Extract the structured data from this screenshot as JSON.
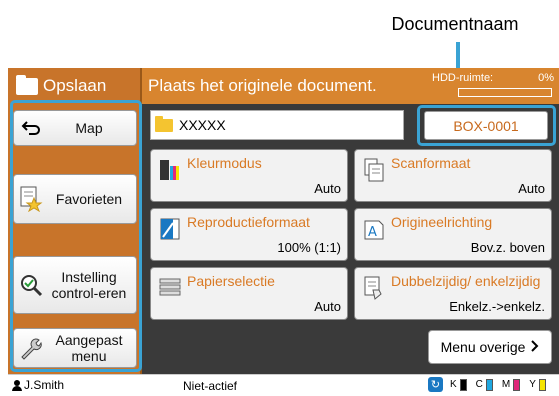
{
  "callout": {
    "label": "Documentnaam"
  },
  "header": {
    "title": "Opslaan",
    "message": "Plaats het originele document.",
    "hdd_label": "HDD-ruimte:",
    "hdd_percent": "0%",
    "hdd_fill": 0
  },
  "sidebar": {
    "items": [
      {
        "label": "Map",
        "icon": "back-arrow-icon"
      },
      {
        "label": "Favorieten",
        "icon": "favorites-star-icon"
      },
      {
        "label": "Instelling control-eren",
        "icon": "magnifier-check-icon"
      },
      {
        "label": "Aangepast menu",
        "icon": "wrench-icon"
      }
    ]
  },
  "main": {
    "document_name": "XXXXX",
    "box_button": "BOX-0001",
    "tiles": [
      {
        "title": "Kleurmodus",
        "value": "Auto"
      },
      {
        "title": "Scanformaat",
        "value": "Auto"
      },
      {
        "title": "Reproductieformaat",
        "value": "100% (1:1)"
      },
      {
        "title": "Origineelrichting",
        "value": "Bov.z. boven"
      },
      {
        "title": "Papierselectie",
        "value": "Auto"
      },
      {
        "title": "Dubbelzijdig/ enkelzijdig",
        "value": "Enkelz.->enkelz."
      }
    ],
    "more_button": "Menu overige"
  },
  "status": {
    "user": "J.Smith",
    "state": "Niet-actief",
    "inks": [
      "K",
      "C",
      "M",
      "Y"
    ],
    "ink_colors": [
      "#000000",
      "#1fa7e0",
      "#e0287a",
      "#f5e400"
    ]
  }
}
